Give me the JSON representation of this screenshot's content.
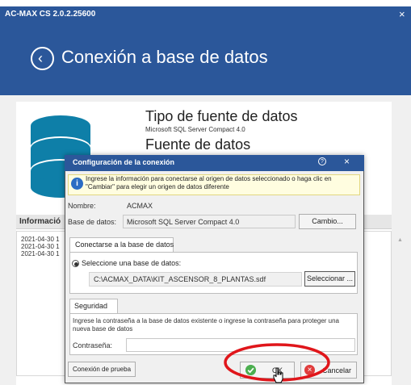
{
  "window": {
    "title": "AC-MAX CS 2.0.2.25600",
    "close_glyph": "×",
    "page_heading": "Conexión a base de datos"
  },
  "source_summary": {
    "tipo_label": "Tipo de fuente de datos",
    "tipo_value": "Microsoft SQL Server Compact 4.0",
    "fuente_label": "Fuente de datos"
  },
  "info_panel": {
    "label": "Informació",
    "log_lines": [
      "2021-04-30 1",
      "2021-04-30 1",
      "2021-04-30 1"
    ]
  },
  "dialog": {
    "title": "Configuración de la conexión",
    "help_glyph": "?",
    "close_glyph": "×",
    "info_text": "Ingrese la información para conectarse al origen de datos seleccionado o haga clic en \"Cambiar\" para elegir un origen de datos diferente",
    "nombre_label": "Nombre:",
    "nombre_value": "ACMAX",
    "base_label": "Base de datos:",
    "base_value": "Microsoft SQL Server Compact 4.0",
    "cambio_label": "Cambio...",
    "tab_conectarse": "Conectarse a la base de datos",
    "radio_label": "Seleccione una base de datos:",
    "path_value": "C:\\ACMAX_DATA\\KIT_ASCENSOR_8_PLANTAS.sdf",
    "select_label": "Seleccionar ...",
    "tab_seguridad": "Seguridad",
    "seguridad_text": "Ingrese la contraseña a la base de datos existente o ingrese la contraseña para proteger una nueva base de datos",
    "password_label": "Contraseña:",
    "test_label": "Conexión de prueba",
    "ok_label": "OK",
    "cancel_label": "Cancelar"
  },
  "colors": {
    "accent_blue": "#2b579a",
    "info_bg": "#fffde0",
    "ok_green": "#4caf50",
    "cancel_red": "#e03c3c",
    "annotation_red": "#e0161b"
  }
}
